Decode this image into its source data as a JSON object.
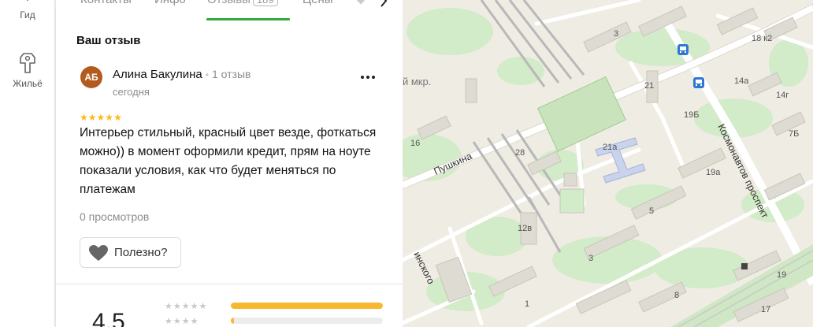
{
  "rail": {
    "items": [
      {
        "label": "Гид",
        "icon": "guide-icon"
      },
      {
        "label": "Жильё",
        "icon": "housing-icon"
      }
    ]
  },
  "tabs": {
    "items": [
      "Контакты",
      "Инфо",
      "Отзывы",
      "Цены"
    ],
    "active_index": 2,
    "reviews_badge": "189"
  },
  "review": {
    "section_title": "Ваш отзыв",
    "avatar_initials": "АБ",
    "author": "Алина Бакулина",
    "author_reviews": "1 отзыв",
    "date": "сегодня",
    "rating": 5,
    "text": "Интерьер стильный, красный цвет везде, фоткаться можно)) в момент оформили кредит, прям на ноуте показали условия, как что будет меняться по платежам",
    "views": "0 просмотров",
    "useful_label": "Полезно?"
  },
  "rating_summary": {
    "value": "4,5",
    "distribution": [
      {
        "stars": 5,
        "fraction": 1.0
      },
      {
        "stars": 4,
        "fraction": 0.02
      }
    ]
  },
  "map": {
    "streets": [
      "Пушкина",
      "Космонавтов проспект",
      "инского"
    ],
    "district_fragment": "й мкр.",
    "house_numbers": [
      "3",
      "18 к2",
      "21",
      "14а",
      "14г",
      "19Б",
      "7Б",
      "16",
      "28",
      "21а",
      "19а",
      "5",
      "12в",
      "3",
      "19",
      "8",
      "17",
      "1"
    ]
  },
  "colors": {
    "accent_green": "#2fab3a",
    "star": "#ffb81a",
    "avatar": "#b35a1f",
    "map_bg": "#efece3",
    "transit": "#2e78d3"
  }
}
